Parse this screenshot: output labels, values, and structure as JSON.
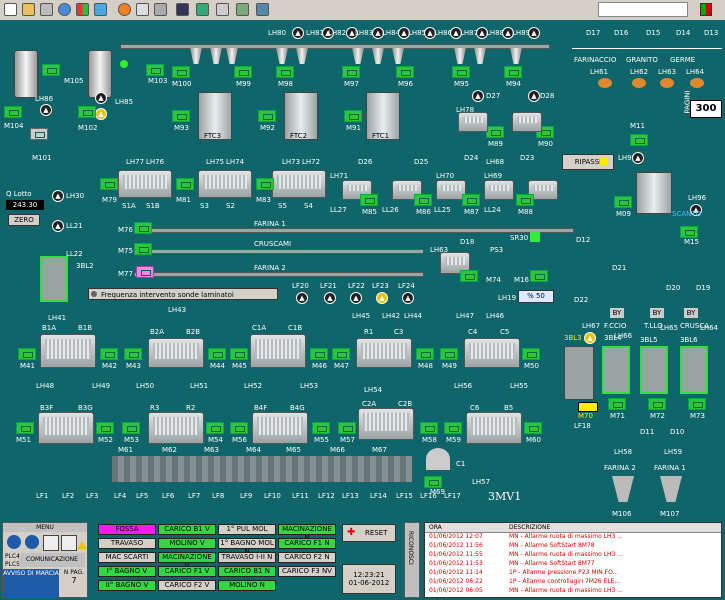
{
  "toolbar": {
    "icons": [
      "new-icon",
      "open-icon",
      "tools-icon",
      "refresh-icon",
      "windows-icon",
      "user-icon",
      "alert-icon",
      "layers-icon",
      "grid-icon",
      "monitor-icon",
      "tree-icon",
      "print-icon",
      "picture-icon",
      "chart-icon"
    ]
  },
  "labels": {
    "top": [
      "LH80",
      "LH81",
      "LH82",
      "LH83",
      "LH84",
      "LH85",
      "LH86",
      "LH87",
      "LH88",
      "LH89"
    ],
    "filters": [
      "D17",
      "D16",
      "D15",
      "D14",
      "D13"
    ],
    "filter_heads": [
      "FARINACCIO",
      "GRANITO",
      "GERME"
    ],
    "lh_right": [
      "LH61",
      "LH62",
      "LH63",
      "LH64"
    ],
    "pagini": "PAGINI",
    "page_num": "300",
    "m_row1": [
      "M100",
      "M99",
      "M98",
      "M97",
      "M96",
      "M95",
      "M94"
    ],
    "m_row1_left": [
      "M105",
      "M103",
      "M104",
      "M102",
      "M101"
    ],
    "lh_left": [
      "LH86",
      "LH85"
    ],
    "m_row2": [
      "M93",
      "M92",
      "M91",
      "M90",
      "M89"
    ],
    "ftc": [
      "FTC3",
      "FTC2",
      "FTC1"
    ],
    "lh_mid": [
      "LH78",
      "LH77",
      "LH76",
      "LH75",
      "LH74",
      "LH73",
      "LH72",
      "LH71",
      "LH70",
      "LH69",
      "LH68"
    ],
    "d_mid": [
      "D27",
      "D28",
      "D26",
      "D25",
      "D24",
      "D23"
    ],
    "m_row3": [
      "M79",
      "M81",
      "M83",
      "M85",
      "M86",
      "M87",
      "M88"
    ],
    "s_labels": [
      "S1A",
      "S1B",
      "S3",
      "S2",
      "S5",
      "S4"
    ],
    "lh_row3b": [
      "LL27",
      "LL26",
      "LL25",
      "LL24"
    ],
    "ripassi": "RIPASSI",
    "m11": "M11",
    "lh95": "LH95",
    "m09": "M09",
    "lh96": "LH96",
    "m15": "M15",
    "scanto": "SCANTO",
    "qlotto": "Q Lotto",
    "qvalue": "243.30",
    "zero": "ZERO",
    "lh30": "LH30",
    "ll21": "LL21",
    "ll22": "LL22",
    "bl2": "3BL2",
    "farina1": "FARINA 1",
    "cruscami": "CRUSCAMI",
    "farina2": "FARINA 2",
    "m76": "M76",
    "m75": "M75",
    "m77": "M77",
    "d18": "D18",
    "lh63": "LH63",
    "sr30": "SR30",
    "ps3": "PS3",
    "m74": "M74",
    "m16": "M16",
    "d12": "D12",
    "pct": "% 50",
    "d21": "D21",
    "d20": "D20",
    "d19": "D19",
    "d22": "D22",
    "lh19": "LH19",
    "freq": "Frequenza intervento sonde laminatoi",
    "lh43": "LH43",
    "lf_row1": [
      "LF20",
      "LF21",
      "LF22",
      "LF23",
      "LF24"
    ],
    "lh_row4": [
      "LH41",
      "LH42",
      "LH45",
      "LH44",
      "LH47",
      "LH46"
    ],
    "roll1": [
      "B1A",
      "B1B",
      "B2A",
      "B2B",
      "C1A",
      "C1B",
      "R1",
      "C3",
      "C4",
      "C5"
    ],
    "m_row4": [
      "M41",
      "M42",
      "M43",
      "M44",
      "M45",
      "M46",
      "M47",
      "M48",
      "M49",
      "M50"
    ],
    "lh_row5": [
      "LH48",
      "LH49",
      "LH50",
      "LH51",
      "LH52",
      "LH53",
      "LH54",
      "LH55",
      "LH56"
    ],
    "roll2": [
      "B3F",
      "B3G",
      "R3",
      "R2",
      "B4F",
      "B4G",
      "C2A",
      "C2B",
      "C6",
      "B5"
    ],
    "m_row5": [
      "M51",
      "M52",
      "M53",
      "M54",
      "M56",
      "M55",
      "M57",
      "M58",
      "M59",
      "M60"
    ],
    "bottom_m": [
      "M61",
      "M62",
      "M63",
      "M64",
      "M65",
      "M66",
      "M67"
    ],
    "c1": "C1",
    "m69": "M69",
    "lh57": "LH57",
    "mv": "3MV1",
    "lf_row2": [
      "LF1",
      "LF2",
      "LF3",
      "LF4",
      "LF5",
      "LF6",
      "LF7",
      "LF8",
      "LF9",
      "LF10",
      "LF11",
      "LF12",
      "LF13",
      "LF14",
      "LF15",
      "LF16",
      "LF17"
    ],
    "bins": [
      "BY",
      "BY",
      "BY"
    ],
    "bin_names": [
      "F.CCIO",
      "T.LLO",
      "CRUSCA"
    ],
    "bl_names": [
      "3BL3",
      "3BL4",
      "3BL5",
      "3BL6"
    ],
    "lh_bins": [
      "LH67",
      "LH66",
      "LH65",
      "LH64"
    ],
    "m_bins": [
      "M70",
      "M71",
      "M72",
      "M73"
    ],
    "lf18": "LF18",
    "d11": "D11",
    "d10": "D10",
    "lh58": "LH58",
    "lh59": "LH59",
    "farina_out": [
      "FARINA 2",
      "FARINA 1"
    ],
    "m_out": [
      "M106",
      "M107"
    ]
  },
  "bottom": {
    "menu": "MENU",
    "plc4": "PLC4",
    "plc5": "PLC5",
    "comunicazione": "COMUNICAZIONE",
    "avviso": "AVVISO DI MARCIA",
    "npag": "N PAG.",
    "npag_val": "7",
    "commands": [
      {
        "label": "FOSSA",
        "style": "mag"
      },
      {
        "label": "CARICO B1 V",
        "style": "green"
      },
      {
        "label": "1° PUL MOL",
        "style": "grey"
      },
      {
        "label": "MACINAZIONE N",
        "style": "green"
      },
      {
        "label": "TRAVASO",
        "style": "grey"
      },
      {
        "label": "MOLINO V",
        "style": "green"
      },
      {
        "label": "1° BAGNO MOL N",
        "style": "grey"
      },
      {
        "label": "CARICO F1 N",
        "style": "green"
      },
      {
        "label": "MAC SCARTI",
        "style": "grey"
      },
      {
        "label": "MACINAZIONE V",
        "style": "green"
      },
      {
        "label": "TRAVASO I-II N",
        "style": "grey"
      },
      {
        "label": "CARICO F2 N",
        "style": "grey"
      },
      {
        "label": "I° BAGNO V",
        "style": "green"
      },
      {
        "label": "CARICO F1 V",
        "style": "green"
      },
      {
        "label": "CARICO B1 N",
        "style": "green"
      },
      {
        "label": "CARICO F3 NV",
        "style": "grey"
      },
      {
        "label": "II° BAGNO V",
        "style": "green"
      },
      {
        "label": "CARICO F2 V",
        "style": "grey"
      },
      {
        "label": "MOLINO N",
        "style": "green"
      }
    ],
    "reset": "RESET",
    "time": "12:23:21",
    "date": "01-06-2012",
    "riconosci": "RICONOSCI",
    "alarm_headers": {
      "ora": "ORA",
      "descr": "DESCRIZIONE"
    },
    "alarms": [
      {
        "ora": "01/06/2012 12:07",
        "descr": "MN - Allarme ruota di massimo LH3 ..."
      },
      {
        "ora": "01/06/2012 11:56",
        "descr": "MN - Allarme SoftStart 8M78"
      },
      {
        "ora": "01/06/2012 11:55",
        "descr": "MN - Allarme ruota di massimo LH3 ..."
      },
      {
        "ora": "01/06/2012 11:53",
        "descr": "MN - Allarme SoftStart 8M77"
      },
      {
        "ora": "01/06/2012 11:14",
        "descr": "1P - Allarme pressione P23 MIN FO..."
      },
      {
        "ora": "01/06/2012 06:22",
        "descr": "1P - Allarme controllagiri 7M26 ELE..."
      },
      {
        "ora": "01/06/2012 06:05",
        "descr": "MN - Allarme ruota di massimo LH3 ..."
      }
    ]
  }
}
